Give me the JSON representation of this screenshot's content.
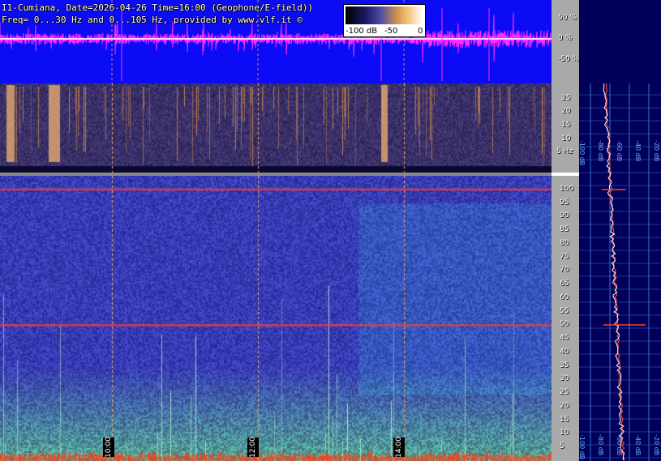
{
  "header": {
    "line1": "I1-Cumiana, Date=2026-04-26 Time=16:00 (Geophone/E-field))",
    "line2": "Freq= 0...30 Hz and 0...105 Hz, provided by www.vlf.it ©"
  },
  "legend": {
    "min_label": "-100 dB",
    "mid_label": "-50",
    "max_label": "0"
  },
  "colors": {
    "waveform_bg": "#0b0bf5",
    "waveform_trace": "#ff2bff",
    "axis_bg": "#a9a9a9",
    "profile_bg": "#00005a",
    "hum_line": "#ff3a2a"
  },
  "time_labels": [
    "10:00",
    "12:00",
    "14:00"
  ],
  "chart_data": [
    {
      "type": "line",
      "name": "waveform",
      "y_tick_labels": [
        "50 %",
        "0 %",
        "-50 %"
      ],
      "y_ticks": [
        50,
        0,
        -50
      ],
      "ylim": [
        -100,
        100
      ]
    },
    {
      "type": "heatmap",
      "name": "spectrogram-0-30Hz",
      "y_tick_labels": [
        "25",
        "20",
        "15",
        "10",
        "5 Hz"
      ],
      "y_ticks": [
        25,
        20,
        15,
        10,
        5
      ],
      "ylim": [
        0,
        30
      ]
    },
    {
      "type": "heatmap",
      "name": "spectrogram-0-105Hz",
      "y_tick_labels": [
        "100",
        "95",
        "90",
        "85",
        "80",
        "75",
        "70",
        "65",
        "60",
        "55",
        "50",
        "45",
        "40",
        "35",
        "30",
        "25",
        "20",
        "15",
        "10",
        "5"
      ],
      "y_ticks": [
        100,
        95,
        90,
        85,
        80,
        75,
        70,
        65,
        60,
        55,
        50,
        45,
        40,
        35,
        30,
        25,
        20,
        15,
        10,
        5
      ],
      "ylim": [
        0,
        105
      ],
      "x_ticks": [
        "10:00",
        "12:00",
        "14:00"
      ],
      "hum_lines_hz": [
        100,
        50
      ]
    },
    {
      "type": "line",
      "name": "spectrum-profile",
      "x_tick_labels": [
        "-100 dB",
        "-80 dB",
        "-60 dB",
        "-40 dB",
        "-20 dB"
      ]
    }
  ]
}
